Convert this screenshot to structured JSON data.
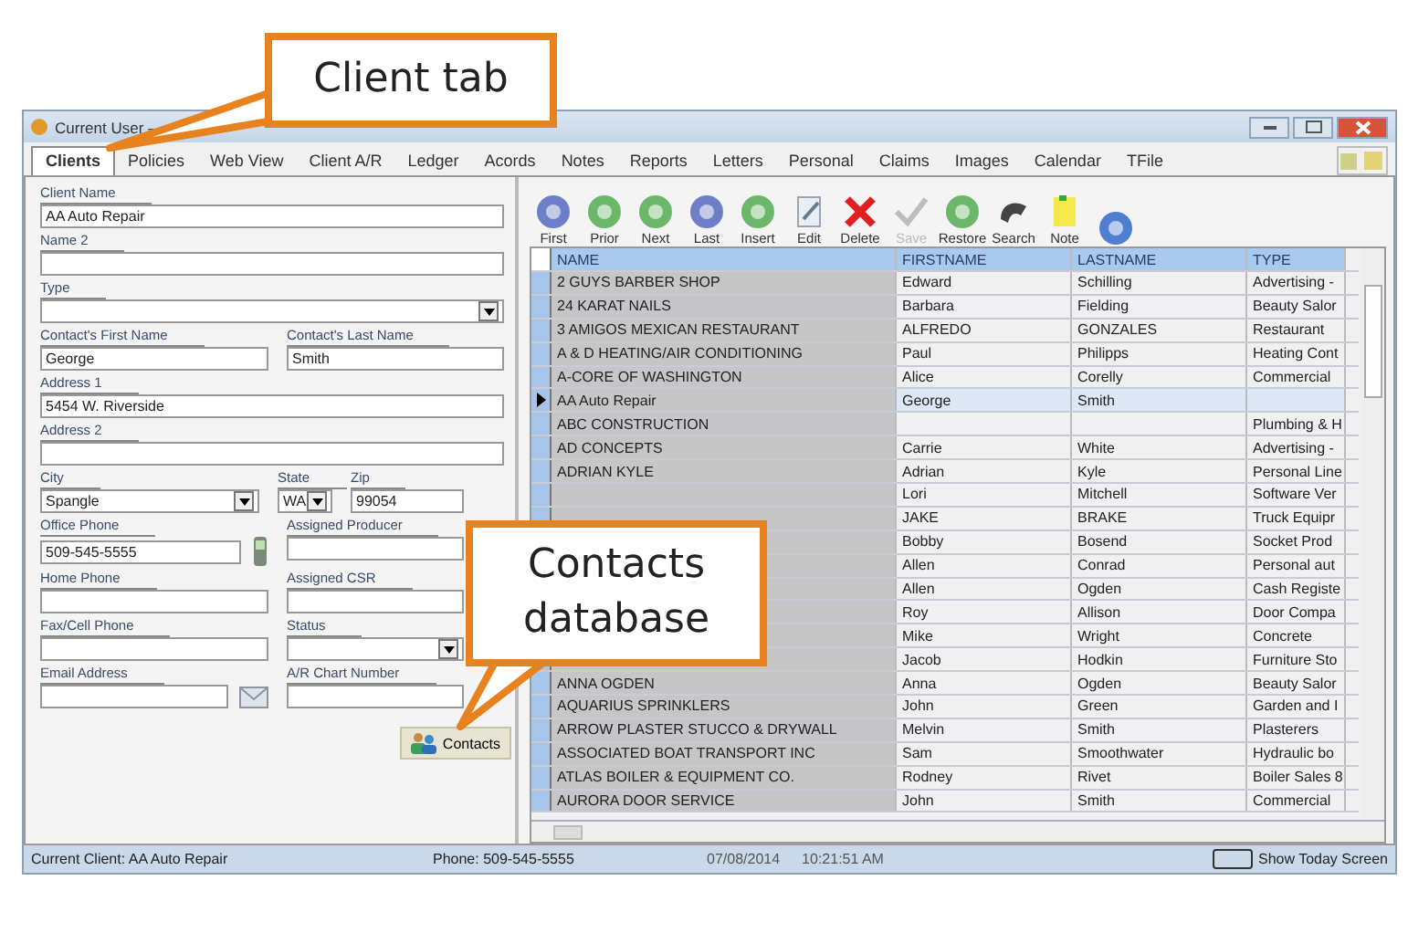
{
  "window": {
    "title": "Current User –"
  },
  "tabs": [
    {
      "label": "Clients",
      "selected": true
    },
    {
      "label": "Policies",
      "selected": false
    },
    {
      "label": "Web View",
      "selected": false
    },
    {
      "label": "Client A/R",
      "selected": false
    },
    {
      "label": "Ledger",
      "selected": false
    },
    {
      "label": "Acords",
      "selected": false
    },
    {
      "label": "Notes",
      "selected": false
    },
    {
      "label": "Reports",
      "selected": false
    },
    {
      "label": "Letters",
      "selected": false
    },
    {
      "label": "Personal",
      "selected": false
    },
    {
      "label": "Claims",
      "selected": false
    },
    {
      "label": "Images",
      "selected": false
    },
    {
      "label": "Calendar",
      "selected": false
    },
    {
      "label": "TFile",
      "selected": false
    }
  ],
  "form": {
    "rows": [
      [
        {
          "label": "Client Name",
          "value": "AA Auto Repair",
          "kind": "text"
        }
      ],
      [
        {
          "label": "Name 2",
          "kind": "text"
        }
      ],
      [
        {
          "label": "Type",
          "kind": "select"
        }
      ],
      [
        {
          "label": "Contact's First Name",
          "value": "George",
          "kind": "text"
        },
        {
          "label": "Contact's Last Name",
          "value": "Smith",
          "kind": "text"
        }
      ],
      [
        {
          "label": "Address 1",
          "value": "5454 W. Riverside",
          "kind": "text"
        }
      ],
      [
        {
          "label": "Address 2",
          "kind": "text"
        }
      ],
      [
        {
          "label": "City",
          "value": "Spangle",
          "kind": "select"
        },
        {
          "label": "State",
          "value": "WA",
          "kind": "select"
        },
        {
          "label": "Zip",
          "value": "99054",
          "kind": "text"
        }
      ],
      [
        {
          "label": "Office Phone",
          "value": "509-545-5555",
          "kind": "phone"
        },
        {
          "label": "Assigned Producer",
          "kind": "text"
        }
      ],
      [
        {
          "label": "Home Phone",
          "kind": "text"
        },
        {
          "label": "Assigned CSR",
          "kind": "text"
        }
      ],
      [
        {
          "label": "Fax/Cell Phone",
          "kind": "text"
        },
        {
          "label": "Status",
          "kind": "select"
        }
      ],
      [
        {
          "label": "Email Address",
          "kind": "email"
        },
        {
          "label": "A/R Chart Number",
          "kind": "text"
        }
      ]
    ],
    "contacts_button": "Contacts"
  },
  "toolbar": [
    {
      "label": "First",
      "disabled": false
    },
    {
      "label": "Prior",
      "disabled": false
    },
    {
      "label": "Next",
      "disabled": false
    },
    {
      "label": "Last",
      "disabled": false
    },
    {
      "label": "Insert",
      "disabled": false
    },
    {
      "label": "Edit",
      "disabled": false
    },
    {
      "label": "Delete",
      "disabled": false
    },
    {
      "label": "Save",
      "disabled": true
    },
    {
      "label": "Restore",
      "disabled": false
    },
    {
      "label": "Search",
      "disabled": false
    },
    {
      "label": "Note",
      "disabled": false
    },
    {
      "disabled": false
    }
  ],
  "table": {
    "columns": [
      "NAME",
      "FIRSTNAME",
      "LASTNAME",
      "TYPE"
    ],
    "rows": [
      {
        "cells": [
          "2 GUYS BARBER SHOP",
          "Edward",
          "Schilling",
          "Advertising -"
        ],
        "selected": false
      },
      {
        "cells": [
          "24 KARAT NAILS",
          "Barbara",
          "Fielding",
          "Beauty Salor"
        ],
        "selected": false
      },
      {
        "cells": [
          "3 AMIGOS MEXICAN RESTAURANT",
          "ALFREDO",
          "GONZALES",
          "Restaurant"
        ],
        "selected": false
      },
      {
        "cells": [
          "A & D HEATING/AIR CONDITIONING",
          "Paul",
          "Philipps",
          "Heating Cont"
        ],
        "selected": false
      },
      {
        "cells": [
          "A-CORE OF WASHINGTON",
          "Alice",
          "Corelly",
          "Commercial"
        ],
        "selected": false
      },
      {
        "cells": [
          "AA Auto Repair",
          "George",
          "Smith",
          null
        ],
        "selected": true
      },
      {
        "cells": [
          "ABC CONSTRUCTION",
          null,
          null,
          "Plumbing & H"
        ],
        "selected": false
      },
      {
        "cells": [
          "AD CONCEPTS",
          "Carrie",
          "White",
          "Advertising -"
        ],
        "selected": false
      },
      {
        "cells": [
          "ADRIAN KYLE",
          "Adrian",
          "Kyle",
          "Personal Line"
        ],
        "selected": false
      },
      {
        "cells": [
          null,
          "Lori",
          "Mitchell",
          "Software Ver"
        ],
        "selected": false
      },
      {
        "cells": [
          null,
          "JAKE",
          "BRAKE",
          "Truck Equipr"
        ],
        "selected": false
      },
      {
        "cells": [
          null,
          "Bobby",
          "Bosend",
          "Socket Prod"
        ],
        "selected": false
      },
      {
        "cells": [
          null,
          "Allen",
          "Conrad",
          "Personal aut"
        ],
        "selected": false
      },
      {
        "cells": [
          null,
          "Allen",
          "Ogden",
          "Cash Registe"
        ],
        "selected": false
      },
      {
        "cells": [
          null,
          "Roy",
          "Allison",
          "Door Compa"
        ],
        "selected": false
      },
      {
        "cells": [
          null,
          "Mike",
          "Wright",
          "Concrete"
        ],
        "selected": false
      },
      {
        "cells": [
          null,
          "Jacob",
          "Hodkin",
          "Furniture Sto"
        ],
        "selected": false
      },
      {
        "cells": [
          "ANNA OGDEN",
          "Anna",
          "Ogden",
          "Beauty Salor"
        ],
        "selected": false
      },
      {
        "cells": [
          "AQUARIUS SPRINKLERS",
          "John",
          "Green",
          "Garden and I"
        ],
        "selected": false
      },
      {
        "cells": [
          "ARROW PLASTER STUCCO & DRYWALL",
          "Melvin",
          "Smith",
          "Plasterers"
        ],
        "selected": false
      },
      {
        "cells": [
          "ASSOCIATED BOAT TRANSPORT INC",
          "Sam",
          "Smoothwater",
          "Hydraulic bo"
        ],
        "selected": false
      },
      {
        "cells": [
          "ATLAS BOILER & EQUIPMENT CO.",
          "Rodney",
          "Rivet",
          "Boiler Sales 8"
        ],
        "selected": false
      },
      {
        "cells": [
          "AURORA DOOR SERVICE",
          "John",
          "Smith",
          "Commercial"
        ],
        "selected": false
      }
    ]
  },
  "status_bar": {
    "client": "Current Client: AA Auto Repair",
    "phone": "Phone: 509-545-5555",
    "date": "07/08/2014",
    "time": "10:21:51 AM",
    "today_label": "Show Today Screen"
  },
  "callouts": [
    {
      "lines": [
        "Client tab"
      ],
      "kind": "tab"
    },
    {
      "lines": [
        "Contacts",
        "database"
      ],
      "kind": "contacts"
    }
  ]
}
